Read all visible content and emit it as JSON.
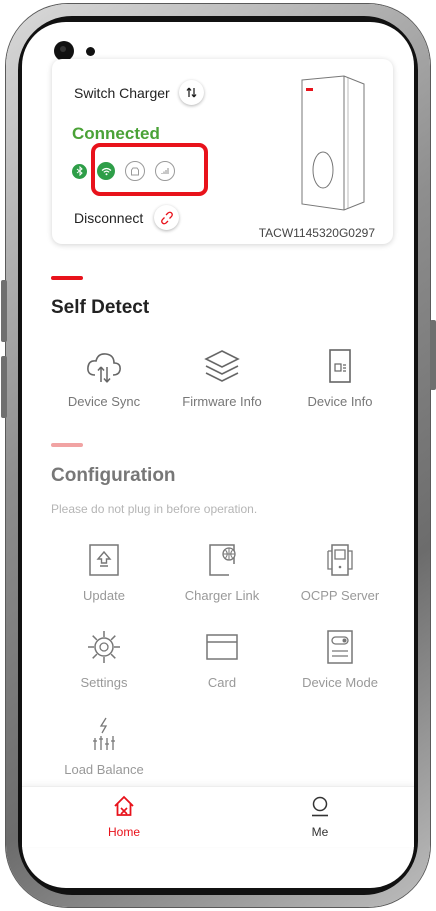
{
  "device_card": {
    "switch_label": "Switch Charger",
    "status": "Connected",
    "disconnect_label": "Disconnect",
    "serial": "TACW1145320G0297",
    "connectivity": [
      "bluetooth-icon",
      "wifi-icon",
      "ethernet-icon",
      "cellular-icon"
    ],
    "colors": {
      "connected": "#4aa237",
      "highlight": "#e8121b"
    }
  },
  "self_detect": {
    "title": "Self Detect",
    "items": [
      {
        "label": "Device Sync",
        "icon": "cloud-sync-icon"
      },
      {
        "label": "Firmware Info",
        "icon": "layers-icon"
      },
      {
        "label": "Device Info",
        "icon": "device-info-icon"
      }
    ]
  },
  "configuration": {
    "title": "Configuration",
    "note": "Please do not plug in before operation.",
    "items": [
      {
        "label": "Update",
        "icon": "update-icon"
      },
      {
        "label": "Charger Link",
        "icon": "charger-link-icon"
      },
      {
        "label": "OCPP Server",
        "icon": "server-icon"
      },
      {
        "label": "Settings",
        "icon": "gear-icon"
      },
      {
        "label": "Card",
        "icon": "card-icon"
      },
      {
        "label": "Device Mode",
        "icon": "device-mode-icon"
      },
      {
        "label": "Load Balance",
        "icon": "load-balance-icon"
      }
    ]
  },
  "tabbar": {
    "home": "Home",
    "me": "Me",
    "accent": "#e8121b"
  }
}
